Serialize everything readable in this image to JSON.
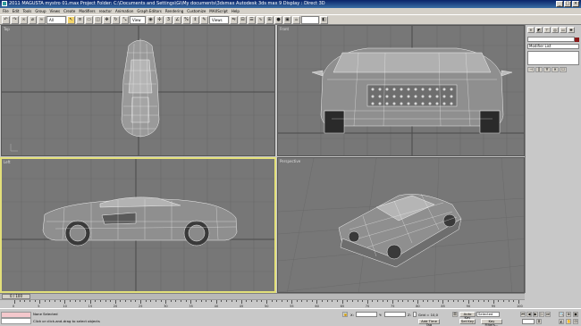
{
  "titlebar": {
    "title": "2011 MAGUSTA mystro 01.max    Project Folder: C:\\Documents and Settings\\Gi\\My documents\\3dsmax    Autodesk 3ds max 9    Display : Direct 3D"
  },
  "menu": {
    "items": [
      "File",
      "Edit",
      "Tools",
      "Group",
      "Views",
      "Create",
      "Modifiers",
      "reactor",
      "Animation",
      "Graph Editors",
      "Rendering",
      "Customize",
      "MAXScript",
      "Help"
    ]
  },
  "toolbar": {
    "selection_filter": "All",
    "coord_system": "View",
    "named_selection": "Views"
  },
  "viewports": {
    "top": {
      "label": "Top"
    },
    "front": {
      "label": "Front"
    },
    "left": {
      "label": "Left"
    },
    "perspective": {
      "label": "Perspective"
    }
  },
  "command_panel": {
    "object_name": "",
    "modifier_list": "Modifier List"
  },
  "timeline": {
    "frame_counter": "0 / 100",
    "ticks": [
      "0",
      "5",
      "10",
      "15",
      "20",
      "25",
      "30",
      "35",
      "40",
      "45",
      "50",
      "55",
      "60",
      "65",
      "70",
      "75",
      "80",
      "85",
      "90",
      "95",
      "100"
    ]
  },
  "status": {
    "selection": "None Selected",
    "prompt": "Click or click-and-drag to select objects",
    "grid": "Grid = 10,0",
    "add_time_tag": "Add Time Tag",
    "auto_key": "Auto Key",
    "set_key": "Set Key",
    "key_mode": "Selected",
    "key_filters": "Key Filters...",
    "x_label": "X:",
    "y_label": "Y:",
    "z_label": "Z:"
  },
  "colors": {
    "viewport_bg": "#777777",
    "active_border": "#e3e07a",
    "grid_line": "#6a6a6a",
    "wire": "#e8e8e8"
  }
}
